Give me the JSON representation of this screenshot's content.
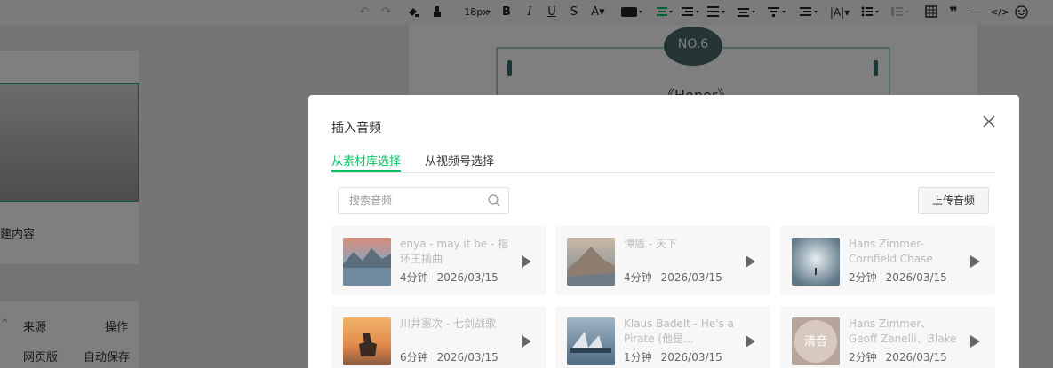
{
  "toolbar": {
    "font_size": "18px"
  },
  "left_panel": {
    "create_text": "建内容",
    "col_source": "来源",
    "col_action": "操作",
    "row_source": "网页版",
    "row_action": "自动保存"
  },
  "article": {
    "badge": "NO.6",
    "heading": "《Honor》"
  },
  "dialog": {
    "title": "插入音频",
    "tabs": [
      "从素材库选择",
      "从视频号选择"
    ],
    "search_placeholder": "搜索音频",
    "upload_label": "上传音频",
    "audio_items": [
      {
        "title": "enya - may it be - 指环王插曲",
        "duration": "4分钟",
        "date": "2026/03/15"
      },
      {
        "title": "谭盾 - 天下",
        "duration": "4分钟",
        "date": "2026/03/15"
      },
      {
        "title": "Hans Zimmer-Cornfield Chase",
        "duration": "2分钟",
        "date": "2026/03/15"
      },
      {
        "title": "川井憲次 - 七剑战歌",
        "duration": "6分钟",
        "date": "2026/03/15"
      },
      {
        "title": "Klaus Badelt - He's a Pirate (他是…",
        "duration": "1分钟",
        "date": "2026/03/15"
      },
      {
        "title": "Hans Zimmer、Geoff Zanelli、Blake N…",
        "duration": "2分钟",
        "date": "2026/03/15"
      }
    ],
    "cover_6_text": "清音"
  },
  "colors": {
    "accent": "#07c160"
  }
}
